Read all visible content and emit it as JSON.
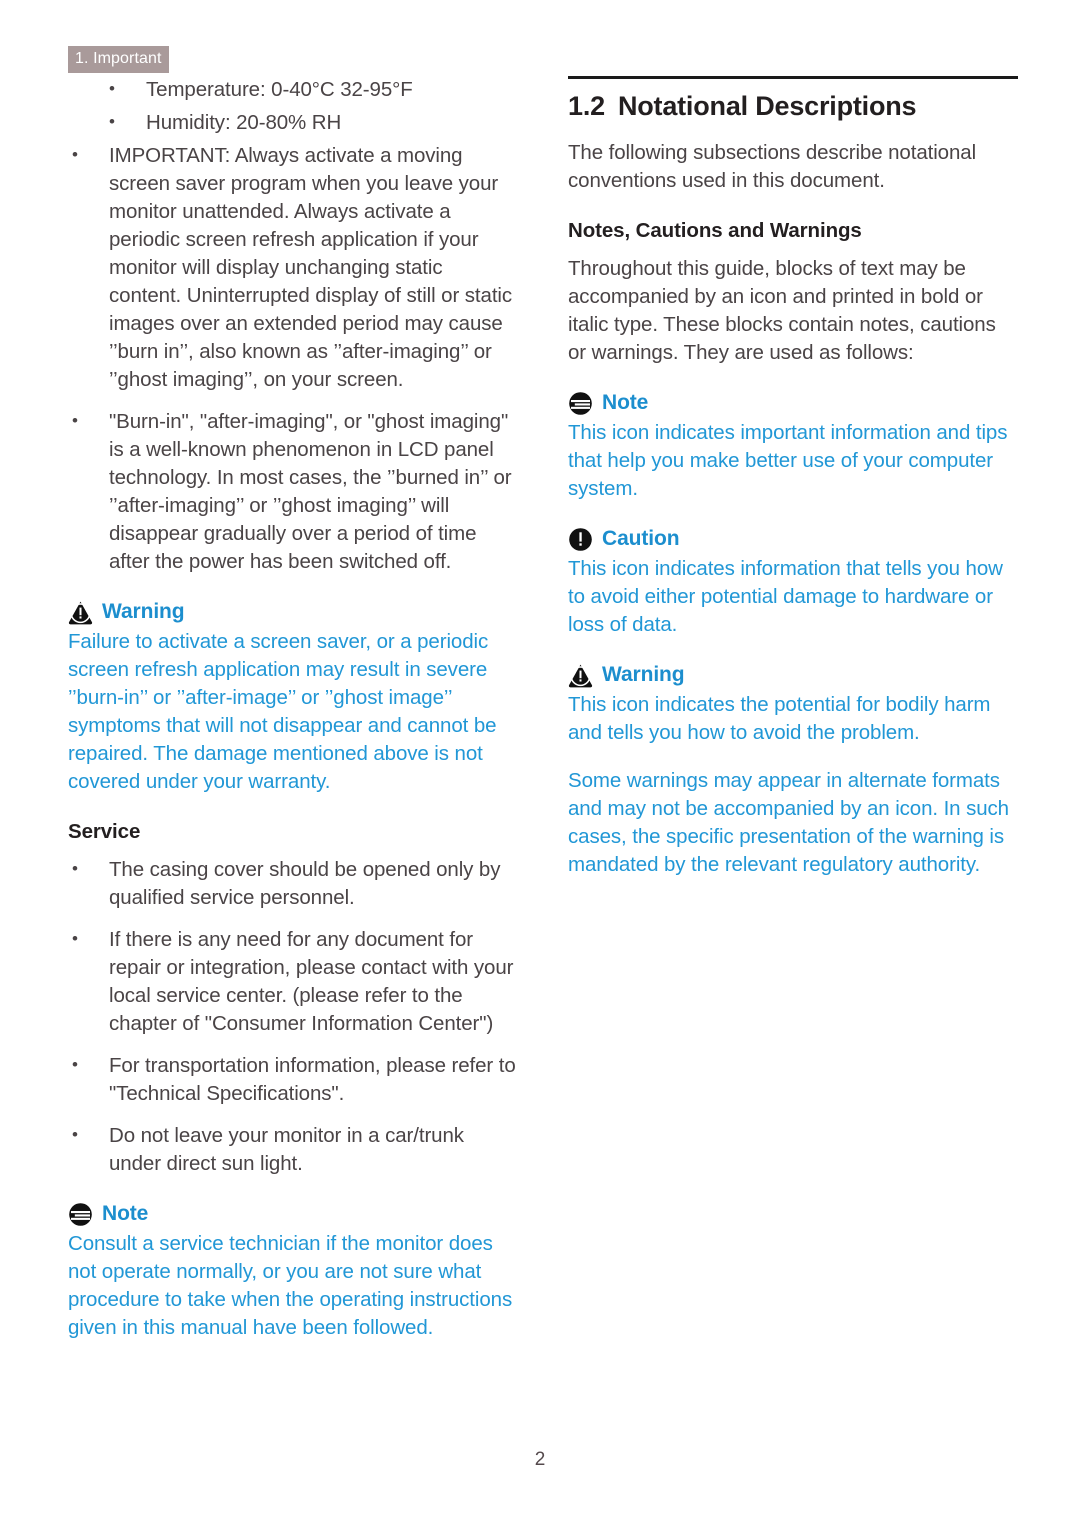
{
  "chapter_badge": "1. Important",
  "page_number": "2",
  "colors": {
    "badge_background": "#a99a9a",
    "badge_text": "#ffffff",
    "body_text": "#4a4446",
    "heading_text": "#231f20",
    "callout_blue": "#2197d6",
    "callout_label_blue": "#1c8ece",
    "rule": "#1a1a1a"
  },
  "left_column": {
    "top_bullets": [
      {
        "text": "Temperature: 0-40°C 32-95°F",
        "indented": true
      },
      {
        "text": "Humidity: 20-80% RH",
        "indented": true
      },
      {
        "text": "IMPORTANT: Always activate a moving screen saver program when you leave your monitor unattended. Always activate a periodic screen refresh application if your monitor will display unchanging static content. Uninterrupted display of still or static images over an extended period may cause ’’burn in’’, also known as ’’after-imaging’’ or ’’ghost imaging’’, on your screen.",
        "indented": false
      },
      {
        "text": "\"Burn-in\", \"after-imaging\", or \"ghost imaging\" is a well-known phenomenon in LCD panel technology. In most cases, the ’’burned in’’ or ’’after-imaging’’ or ’’ghost imaging’’ will disappear gradually over a period of time after the power has been switched off.",
        "indented": false
      }
    ],
    "warning_callout": {
      "icon": "warning-triangle-icon",
      "label": "Warning",
      "body": "Failure to activate a screen saver, or a periodic screen refresh application may result in severe ’’burn-in’’ or ’’after-image’’ or ’’ghost image’’ symptoms that will not disappear and cannot be repaired. The damage mentioned above is not covered under your warranty."
    },
    "service_heading": "Service",
    "service_bullets": [
      {
        "text": "The casing cover should be opened only by qualified service personnel."
      },
      {
        "text": "If there is any need for any document for repair or integration, please contact with your local service center. (please refer to the chapter of \"Consumer Information Center\")"
      },
      {
        "text": "For transportation information, please refer to \"Technical Specifications\"."
      },
      {
        "text": "Do not leave your monitor in a car/trunk under direct sun light."
      }
    ],
    "note_callout": {
      "icon": "note-circle-icon",
      "label": "Note",
      "body": "Consult a service technician if the monitor does not operate normally, or you are not sure what procedure to take when the operating instructions given in this manual have been followed."
    }
  },
  "right_column": {
    "section_number": "1.2",
    "section_title": "Notational Descriptions",
    "intro": "The following subsections describe notational conventions used in this document.",
    "sub_heading": "Notes, Cautions and Warnings",
    "sub_intro": "Throughout this guide, blocks of text may be accompanied by an icon and printed in bold or italic type. These blocks contain notes, cautions or warnings. They are used as follows:",
    "note_callout": {
      "icon": "note-circle-icon",
      "label": "Note",
      "body": "This icon indicates important information and tips that help you make better use of your computer system."
    },
    "caution_callout": {
      "icon": "caution-circle-icon",
      "label": "Caution",
      "body": "This icon indicates information that tells you how to avoid either potential damage to hardware or loss of data."
    },
    "warning_callout": {
      "icon": "warning-triangle-icon",
      "label": "Warning",
      "body": "This icon indicates the potential for bodily harm and tells you how to avoid the problem."
    },
    "closing_paragraph": "Some warnings may appear in alternate formats and may not be accompanied by an icon. In such cases, the specific presentation of the warning is mandated by the relevant regulatory authority."
  }
}
